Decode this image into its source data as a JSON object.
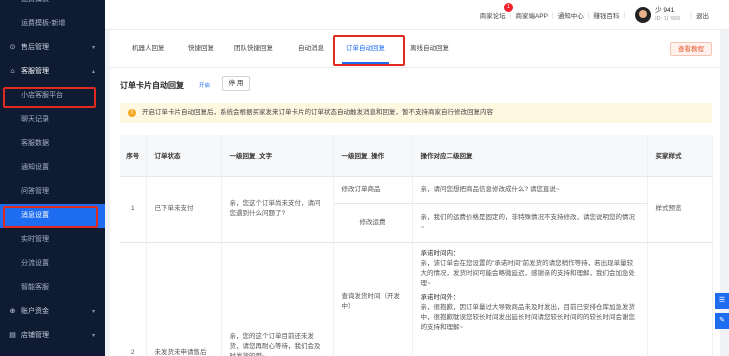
{
  "sidebar": {
    "items": [
      {
        "label": "运费模板",
        "type": "item"
      },
      {
        "label": "运费模板-新增",
        "type": "item"
      },
      {
        "label": "售后管理",
        "type": "group",
        "icon": "⊙",
        "icon_name": "circle-icon"
      },
      {
        "label": "客服管理",
        "type": "group",
        "icon": "⌂",
        "icon_name": "headset-icon",
        "open": true
      },
      {
        "label": "小店客服平台",
        "type": "item"
      },
      {
        "label": "聊天记录",
        "type": "item"
      },
      {
        "label": "客服数据",
        "type": "item"
      },
      {
        "label": "通知设置",
        "type": "item"
      },
      {
        "label": "问答管理",
        "type": "item"
      },
      {
        "label": "消息设置",
        "type": "item",
        "active": true
      },
      {
        "label": "实时管理",
        "type": "item"
      },
      {
        "label": "分流设置",
        "type": "item"
      },
      {
        "label": "智能客服",
        "type": "item"
      },
      {
        "label": "账户资金",
        "type": "group",
        "icon": "⊕",
        "icon_name": "wallet-icon"
      },
      {
        "label": "店铺管理",
        "type": "group",
        "icon": "▤",
        "icon_name": "store-icon"
      }
    ]
  },
  "topbar": {
    "links": [
      "商家论坛",
      "商家端APP",
      "通知中心",
      "赚钱百科"
    ],
    "forum_badge": "1",
    "username": "少 941",
    "user_id": "ID: 1( '666",
    "logout": "退出"
  },
  "tabs": [
    "机器人回复",
    "快捷回复",
    "团队快捷回复",
    "自动消息",
    "订单自动回复",
    "离线自动回复"
  ],
  "active_tab": "订单自动回复",
  "tutorial_button": "查看教程",
  "section": {
    "title": "订单卡片自动回复",
    "status": "开启",
    "disable_button": "停 用"
  },
  "notice": {
    "icon": "!",
    "text": "开启订单卡片自动回复后，系统会根据买家发来订单卡片的订单状态自动触发消息和回复，暂不支持商家自行修改回复内容"
  },
  "table": {
    "headers": [
      "序号",
      "订单状态",
      "一级回复_文字",
      "一级回复_操作",
      "操作对应二级回复",
      "买家样式"
    ],
    "row1": {
      "index": "1",
      "status": "已下单未支付",
      "level1_text": "亲，您这个订单尚未支付，请问您遇到什么问题了?",
      "action1": "修改订单商品",
      "reply1": "亲，请问您想把商品信息修改成什么? 请您直说~",
      "action2": "修改运费",
      "reply2": "亲，我们的运费价格是固定的，非特殊情况不支持修改，请您说明您的情况~",
      "buyer_style": "样式预览"
    },
    "row2": {
      "index": "2",
      "status": "未发货未申请售后",
      "level1_text": "亲，您的这个订单目前还未发货，请您再耐心等待，我们会及时发货的哦~",
      "action": "查询发货时间（开发中）",
      "promise_label": "承诺时间内：",
      "promise_text": "亲，该订单会在您设置的\"承诺时间\"前发货的请您稍作等待，若出现单量较大的情况，发货时间可能会略微延迟，感谢亲的支持和理解，我们会加急处理~",
      "overdue_label": "承诺时间外：",
      "overdue_text": "亲，很抱歉，因订单量过大导致商品未及时发出，目前已安排仓库加急发货中，很抱歉耽误您较长时间发出延长时间请您较长时间的的较长时间会谢您的支持和理解~"
    }
  },
  "float_buttons": [
    "☰",
    "✎"
  ]
}
